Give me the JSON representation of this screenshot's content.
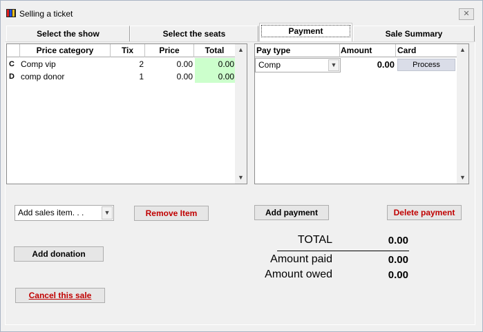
{
  "window": {
    "title": "Selling a ticket",
    "close_glyph": "✕"
  },
  "tabs": [
    {
      "label": "Select the show"
    },
    {
      "label": "Select the seats"
    },
    {
      "label": "Payment"
    },
    {
      "label": "Sale Summary"
    }
  ],
  "items_table": {
    "columns": [
      "Price category",
      "Tix",
      "Price",
      "Total"
    ],
    "rows": [
      {
        "code": "C",
        "category": "Comp vip",
        "tix": "2",
        "price": "0.00",
        "total": "0.00"
      },
      {
        "code": "D",
        "category": "comp donor",
        "tix": "1",
        "price": "0.00",
        "total": "0.00"
      }
    ]
  },
  "payment_table": {
    "columns": [
      "Pay type",
      "Amount",
      "Card"
    ],
    "rows": [
      {
        "pay_type": "Comp",
        "amount": "0.00",
        "card_button": "Process"
      }
    ]
  },
  "controls": {
    "add_sales_item": "Add sales item. . .",
    "remove_item": "Remove Item",
    "add_donation": "Add donation",
    "cancel_sale": "Cancel this sale",
    "add_payment": "Add payment",
    "delete_payment": "Delete payment"
  },
  "summary": {
    "total_label": "TOTAL",
    "total_value": "0.00",
    "paid_label": "Amount paid",
    "paid_value": "0.00",
    "owed_label": "Amount owed",
    "owed_value": "0.00"
  },
  "colors": {
    "total_highlight": "#ccffcc",
    "danger_text": "#c00000"
  }
}
